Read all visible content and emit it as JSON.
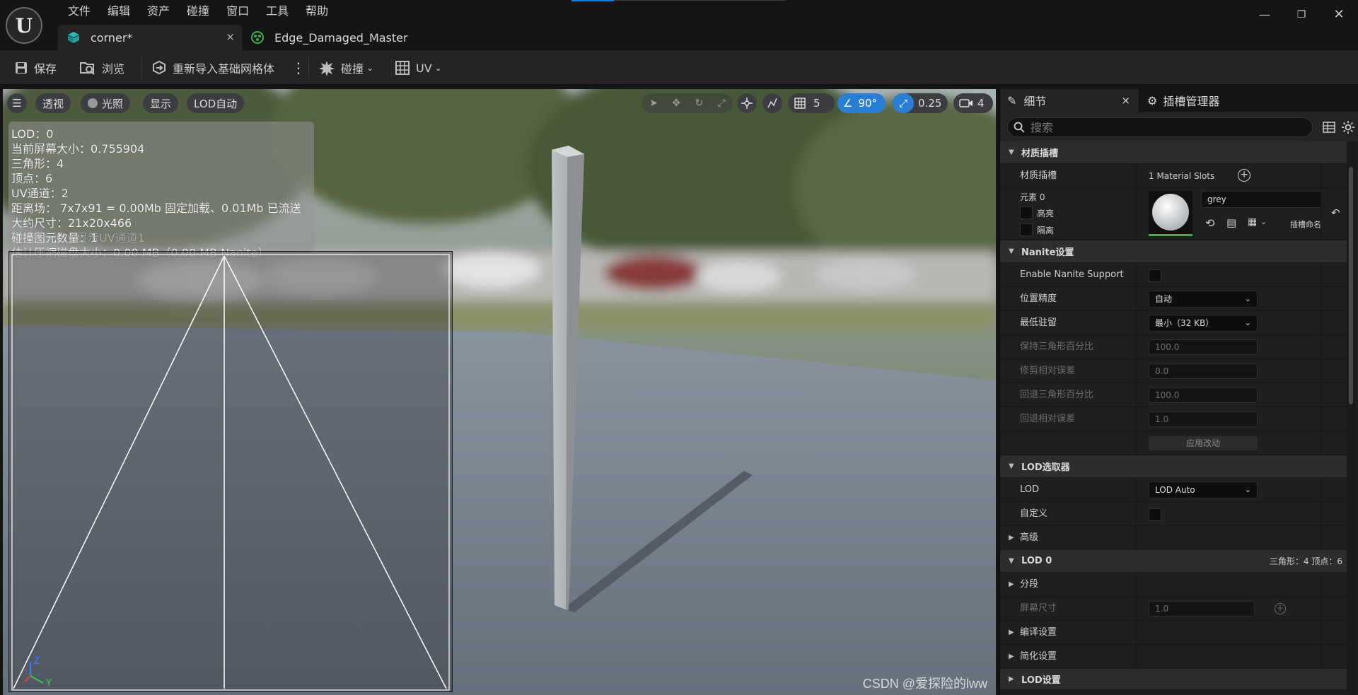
{
  "menu": [
    "文件",
    "编辑",
    "资产",
    "碰撞",
    "窗口",
    "工具",
    "帮助"
  ],
  "tabs": [
    {
      "label": "corner*",
      "active": true
    },
    {
      "label": "Edge_Damaged_Master",
      "active": false
    }
  ],
  "tab_close": "×",
  "window_controls": {
    "minimize": "—",
    "restore": "❐",
    "close": "✕"
  },
  "toolbar": {
    "save": "保存",
    "browse": "浏览",
    "reimport": "重新导入基础网格体",
    "more": "⋮",
    "collision": "碰撞",
    "uv": "UV"
  },
  "viewport": {
    "menu_icon": "☰",
    "perspective": "透视",
    "lit": "光照",
    "show": "显示",
    "lod": "LOD自动",
    "grid_size": "5",
    "rotation_snap": "90°",
    "scale_snap": "0.25",
    "camera_speed": "4",
    "stats": [
      "LOD：0",
      "当前屏幕大小：0.755904",
      "三角形：4",
      "顶点：6",
      "UV通道：2",
      "距离场： 7x7x91 = 0.00Mb 固定加载、0.01Mb 已流送",
      "大约尺寸：21x20x466",
      "碰撞图元数量：1",
      "估计压缩磁盘大小：0.00 MB（0.00 MB Nanite）"
    ],
    "uv_overlay": "显示UV通道1",
    "axis_z": "Z",
    "axis_y": "Y",
    "watermark": "CSDN @爱探险的lww"
  },
  "details": {
    "tab_details": "细节",
    "tab_close": "×",
    "tab_sockets": "插槽管理器",
    "search_placeholder": "搜索",
    "sections": {
      "material_slots": "材质插槽",
      "nanite": "Nanite设置",
      "lod_picker": "LOD选取器",
      "advanced": "高级",
      "lod0": "LOD 0",
      "lod0_info": "三角形：4   顶点：6",
      "sections": "分段",
      "build": "编译设置",
      "reduction": "简化设置",
      "lod_settings": "LOD设置"
    },
    "material": {
      "label": "材质插槽",
      "count": "1 Material Slots",
      "element": "元素 0",
      "highlight": "高亮",
      "isolate": "隔离",
      "name": "grey",
      "slot_name": "插槽命名"
    },
    "nanite": {
      "enable": "Enable Nanite Support",
      "position_precision": "位置精度",
      "position_precision_value": "自动",
      "min_residency": "最低驻留",
      "min_residency_value": "最小（32 KB）",
      "keep_percent": "保持三角形百分比",
      "keep_percent_value": "100.0",
      "trim_error": "修剪相对误差",
      "trim_error_value": "0.0",
      "fallback_percent": "回退三角形百分比",
      "fallback_percent_value": "100.0",
      "fallback_error": "回退相对误差",
      "fallback_error_value": "1.0",
      "apply": "应用改动"
    },
    "lod": {
      "label": "LOD",
      "value": "LOD Auto",
      "custom": "自定义",
      "screen_size": "屏幕尺寸",
      "screen_size_value": "1.0"
    }
  }
}
